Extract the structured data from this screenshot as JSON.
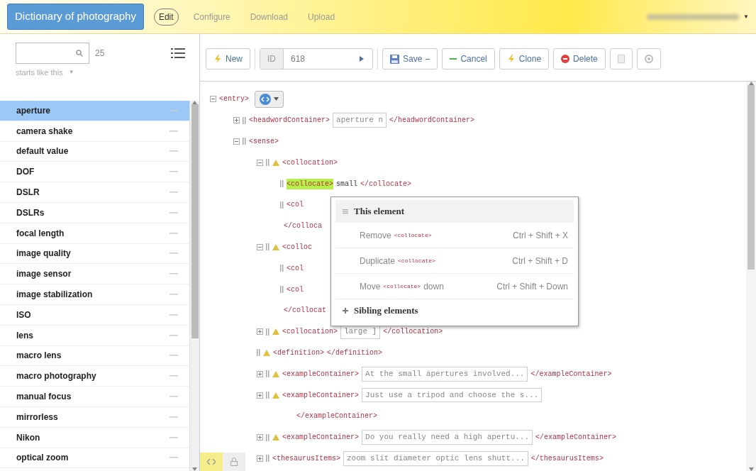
{
  "header": {
    "brand": "Dictionary of photography",
    "nav": [
      {
        "label": "Edit",
        "selected": true
      },
      {
        "label": "Configure",
        "selected": false
      },
      {
        "label": "Download",
        "selected": false
      },
      {
        "label": "Upload",
        "selected": false
      }
    ],
    "account_caret": "▼"
  },
  "sidebar": {
    "count": "25",
    "filter": "starts like this",
    "filter_caret": "▼",
    "items": [
      {
        "label": "aperture",
        "selected": true
      },
      {
        "label": "camera shake",
        "selected": false
      },
      {
        "label": "default value",
        "selected": false
      },
      {
        "label": "DOF",
        "selected": false
      },
      {
        "label": "DSLR",
        "selected": false
      },
      {
        "label": "DSLRs",
        "selected": false
      },
      {
        "label": "focal length",
        "selected": false
      },
      {
        "label": "image quality",
        "selected": false
      },
      {
        "label": "image sensor",
        "selected": false
      },
      {
        "label": "image stabilization",
        "selected": false
      },
      {
        "label": "ISO",
        "selected": false
      },
      {
        "label": "lens",
        "selected": false
      },
      {
        "label": "macro lens",
        "selected": false
      },
      {
        "label": "macro photography",
        "selected": false
      },
      {
        "label": "manual focus",
        "selected": false
      },
      {
        "label": "mirrorless",
        "selected": false
      },
      {
        "label": "Nikon",
        "selected": false
      },
      {
        "label": "optical zoom",
        "selected": false
      }
    ]
  },
  "toolbar": {
    "new": "New",
    "id_label": "ID",
    "id_value": "618",
    "save": "Save",
    "cancel": "Cancel",
    "clone": "Clone",
    "delete": "Delete"
  },
  "tree": {
    "root": {
      "open": "<entry>",
      "expanded": true,
      "children": [
        {
          "open": "<headwordContainer>",
          "expanded": false,
          "value": "aperture n",
          "close": "</headwordContainer>"
        },
        {
          "open": "<sense>",
          "expanded": true,
          "children": [
            {
              "open": "<collocation>",
              "expanded": true,
              "warning": true,
              "children": [
                {
                  "open": "<collocate>",
                  "highlighted": true,
                  "text": "small",
                  "close": "</collocate>"
                },
                {
                  "open": "<col"
                }
              ],
              "close": "</colloca"
            },
            {
              "open": "<colloc",
              "expanded": true,
              "warning": true,
              "children": [
                {
                  "open": "<col"
                },
                {
                  "open": "<col"
                }
              ],
              "close": "</collocat"
            },
            {
              "open": "<collocation>",
              "expanded": false,
              "warning": true,
              "value": "large ]",
              "close": "</collocation>"
            },
            {
              "open": "<definition>",
              "warning": true,
              "close": "</definition>"
            },
            {
              "open": "<exampleContainer>",
              "expanded": false,
              "warning": true,
              "value": "At the small apertures involved...",
              "close": "</exampleContainer>"
            },
            {
              "open": "<exampleContainer>",
              "expanded": false,
              "warning": true,
              "value": "Just use a tripod and choose the s...",
              "close": "</exampleContainer>",
              "close_below": true
            },
            {
              "open": "<exampleContainer>",
              "expanded": false,
              "warning": true,
              "value": "Do you really need a high apertu...",
              "close": "</exampleContainer>"
            },
            {
              "open": "<thesaurusItems>",
              "expanded": false,
              "value": "zoom slit diameter optic lens shutt...",
              "close": "</thesaurusItems>"
            }
          ]
        }
      ]
    }
  },
  "menu": [
    {
      "kind": "header",
      "label": "This element",
      "expanded": true
    },
    {
      "kind": "item",
      "label": "Remove",
      "tag": "<collocate>",
      "shortcut": "Ctrl + Shift + X"
    },
    {
      "kind": "item",
      "label": "Duplicate",
      "tag": "<collocate>",
      "shortcut": "Ctrl + Shift + D"
    },
    {
      "kind": "item",
      "label": "Move",
      "tag": "<collocate>",
      "suffix": "down",
      "shortcut": "Ctrl + Shift + Down"
    },
    {
      "kind": "header",
      "label": "Sibling elements",
      "expanded": false
    }
  ],
  "bottom_tools": [
    {
      "kind": "code",
      "selected": true
    },
    {
      "kind": "lock",
      "selected": false
    }
  ]
}
